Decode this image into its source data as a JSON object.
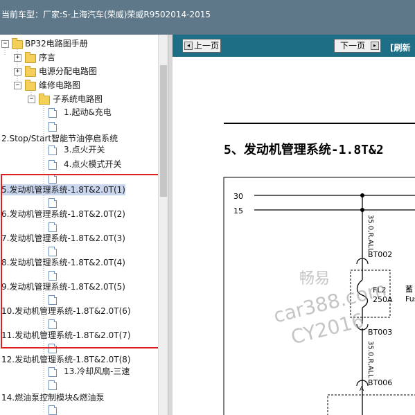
{
  "title_bar": {
    "label": "当前车型：",
    "vehicle": "厂家:S-上海汽车(荣威)荣威R9502014-2015"
  },
  "tree": [
    {
      "label": "BP32电路图手册",
      "icon": "folder-icon",
      "expander": "−"
    },
    {
      "label": "序言",
      "icon": "folder-icon",
      "expander": "+"
    },
    {
      "label": "电源分配电路图",
      "icon": "folder-icon",
      "expander": "+"
    },
    {
      "label": "维修电路图",
      "icon": "folder-icon",
      "expander": "−"
    },
    {
      "label": "子系统电路图",
      "icon": "folder-icon",
      "expander": "−"
    },
    {
      "label": "1.起动&充电",
      "icon": "document-icon"
    },
    {
      "label": "2.Stop/Start智能节油停启系统",
      "icon": "document-icon"
    },
    {
      "label": "3.点火开关",
      "icon": "document-icon"
    },
    {
      "label": "4.点火模式开关",
      "icon": "document-icon"
    },
    {
      "label": "5.发动机管理系统-1.8T&2.0T(1)",
      "icon": "document-icon",
      "selected": true
    },
    {
      "label": "6.发动机管理系统-1.8T&2.0T(2)",
      "icon": "document-icon"
    },
    {
      "label": "7.发动机管理系统-1.8T&2.0T(3)",
      "icon": "document-icon"
    },
    {
      "label": "8.发动机管理系统-1.8T&2.0T(4)",
      "icon": "document-icon"
    },
    {
      "label": "9.发动机管理系统-1.8T&2.0T(5)",
      "icon": "document-icon"
    },
    {
      "label": "10.发动机管理系统-1.8T&2.0T(6)",
      "icon": "document-icon"
    },
    {
      "label": "11.发动机管理系统-1.8T&2.0T(7)",
      "icon": "document-icon"
    },
    {
      "label": "12.发动机管理系统-1.8T&2.0T(8)",
      "icon": "document-icon"
    },
    {
      "label": "13.冷却风扇-三速",
      "icon": "document-icon"
    },
    {
      "label": "14.燃油泵控制模块&燃油泵",
      "icon": "document-icon"
    }
  ],
  "toolbar": {
    "prev": "上一页",
    "next": "下一页",
    "refresh": "[刷新"
  },
  "document": {
    "heading": "5、发动机管理系统-1.8T&2",
    "diagram": {
      "rail_30": "30",
      "rail_15": "15",
      "wire_top": "35.0,R,ALL",
      "connector_top": "BT002",
      "fuse_name": "FL2",
      "fuse_rating": "250A",
      "side_text_1": "蓄",
      "side_text_2": "Fus",
      "connector_mid": "BT003",
      "wire_bottom": "35.0,R,ALL",
      "connector_bottom": "BT006",
      "pin": "A"
    }
  },
  "watermark": {
    "brand": "畅易",
    "site": "car388.com",
    "code": "CY2016"
  },
  "colors": {
    "titlebar": "#5f7889",
    "toolbar": "#1e6f86",
    "highlight_box": "#e02020",
    "selection": "#c9d6ee"
  }
}
